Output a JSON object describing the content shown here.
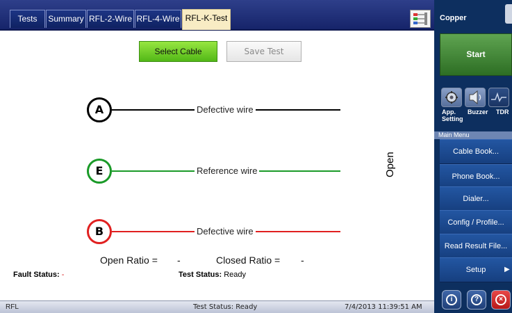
{
  "tabs": [
    {
      "label": "Tests"
    },
    {
      "label": "Summary"
    },
    {
      "label": "RFL-2-Wire"
    },
    {
      "label": "RFL-4-Wire"
    },
    {
      "label": "RFL-K-Test",
      "active": true
    }
  ],
  "toolbar": {
    "select_cable_label": "Select Cable",
    "save_test_label": "Save Test"
  },
  "wires": [
    {
      "letter": "A",
      "label": "Defective wire",
      "color": "#000000"
    },
    {
      "letter": "E",
      "label": "Reference wire",
      "color": "#1a9a28"
    },
    {
      "letter": "B",
      "label": "Defective wire",
      "color": "#e02020"
    }
  ],
  "open_label": "Open",
  "ratios": {
    "open_label": "Open Ratio =",
    "open_value": "-",
    "closed_label": "Closed Ratio =",
    "closed_value": "-"
  },
  "status": {
    "fault_label": "Fault Status:",
    "fault_value": "-",
    "test_label": "Test Status:",
    "test_value": "Ready"
  },
  "statusbar": {
    "left": "RFL",
    "center": "Test Status: Ready",
    "right": "7/4/2013 11:39:51 AM"
  },
  "side_panel": {
    "title": "Copper",
    "start_label": "Start",
    "tools": [
      {
        "label": "App.\nSetting",
        "icon": "settings-icon"
      },
      {
        "label": "Buzzer",
        "icon": "buzzer-icon"
      },
      {
        "label": "TDR",
        "icon": "tdr-icon"
      }
    ],
    "main_menu_label": "Main Menu",
    "menu": [
      {
        "label": "Cable Book..."
      },
      {
        "label": "Phone Book..."
      },
      {
        "label": "Dialer..."
      },
      {
        "label": "Config / Profile..."
      },
      {
        "label": "Read Result File..."
      },
      {
        "label": "Setup",
        "arrow": "▶"
      }
    ]
  },
  "colors": {
    "accent_green": "#52b817",
    "panel_blue": "#0d2f5f",
    "reference_green": "#1a9a28",
    "defective_red": "#e02020"
  }
}
